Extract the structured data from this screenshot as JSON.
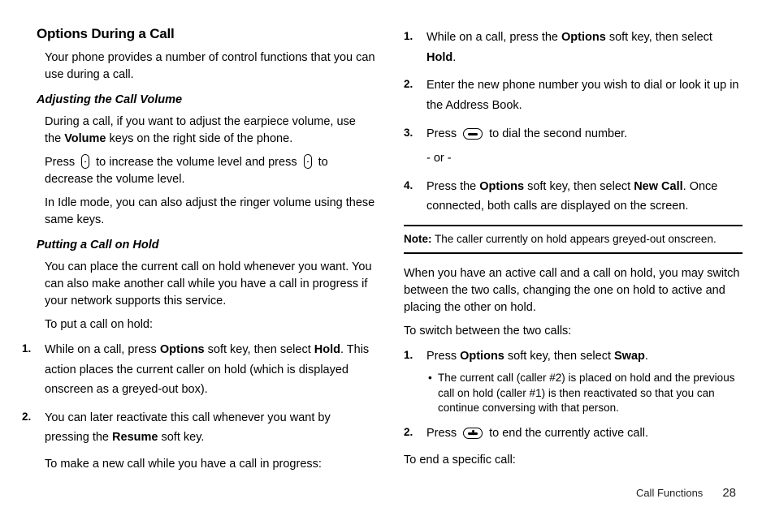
{
  "left": {
    "h2": "Options During a Call",
    "intro": "Your phone provides a number of control functions that you can use during a call.",
    "h3a": "Adjusting the Call Volume",
    "vol_p1a": "During a call, if you want to adjust the earpiece volume, use the ",
    "vol_bold": "Volume",
    "vol_p1b": " keys on the right side of the phone.",
    "vol_p2a": "Press ",
    "vol_p2b": " to increase the volume level and press ",
    "vol_p2c": " to decrease the volume level.",
    "vol_p3": "In Idle mode, you can also adjust the ringer volume using these same keys.",
    "h3b": "Putting a Call on Hold",
    "hold_p1": "You can place the current call on hold whenever you want. You can also make another call while you have a call in progress if your network supports this service.",
    "hold_p2": "To put a call on hold:",
    "hold_li1_a": "While on a call, press ",
    "hold_li1_b": "Options",
    "hold_li1_c": " soft key, then select ",
    "hold_li1_d": "Hold",
    "hold_li1_e": ". This action places the current caller on hold (which is displayed onscreen as a greyed-out box).",
    "hold_li2_a": "You can later reactivate this call whenever you want by pressing the ",
    "hold_li2_b": "Resume",
    "hold_li2_c": " soft key.",
    "hold_p3": "To make a new call while you have a call in progress:"
  },
  "right": {
    "li1_a": "While on a call, press the ",
    "li1_b": "Options",
    "li1_c": " soft key, then select ",
    "li1_d": "Hold",
    "li1_e": ".",
    "li2": "Enter the new phone number you wish to dial or look it up in the Address Book.",
    "li3_a": "Press ",
    "li3_b": " to dial the second number.",
    "li3_or": "- or -",
    "li4_a": "Press the ",
    "li4_b": "Options",
    "li4_c": " soft key, then select ",
    "li4_d": "New Call",
    "li4_e": ". Once connected, both calls are displayed on the screen.",
    "note_label": "Note:",
    "note_text": " The caller currently on hold appears greyed-out onscreen.",
    "after_p1": "When you have an active call and a call on hold, you may switch between the two calls, changing the one on hold to active and placing the other on hold.",
    "after_p2": "To switch between the two calls:",
    "sw_li1_a": "Press ",
    "sw_li1_b": "Options",
    "sw_li1_c": " soft key, then select ",
    "sw_li1_d": "Swap",
    "sw_li1_e": ".",
    "sw_bullet": "The current call (caller #2) is placed on hold and the previous call on hold (caller #1) is then reactivated so that you can continue conversing with that person.",
    "sw_li2_a": "Press ",
    "sw_li2_b": " to end the currently active call.",
    "after_p3": "To end a specific call:"
  },
  "footer": {
    "section": "Call Functions",
    "page": "28"
  },
  "nums": {
    "n1": "1.",
    "n2": "2.",
    "n3": "3.",
    "n4": "4."
  }
}
